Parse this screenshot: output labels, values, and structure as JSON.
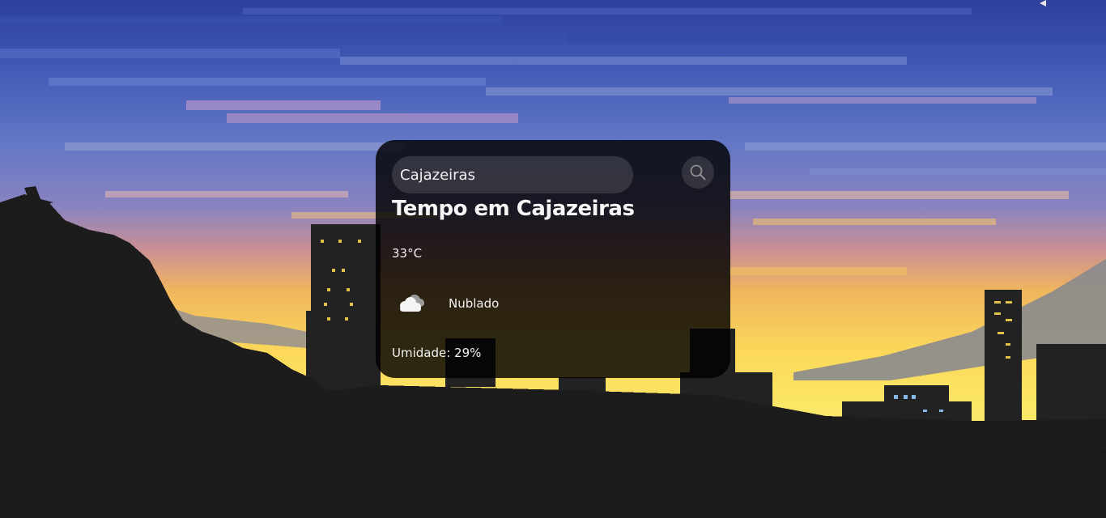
{
  "search": {
    "value": "Cajazeiras",
    "icon": "search-icon"
  },
  "weather": {
    "title": "Tempo em Cajazeiras",
    "temperature": "33°C",
    "condition_icon": "cloud-icon",
    "condition": "Nublado",
    "humidity": "Umidade: 29%"
  },
  "colors": {
    "card_background": "#000000",
    "text": "#f2f2f2"
  }
}
